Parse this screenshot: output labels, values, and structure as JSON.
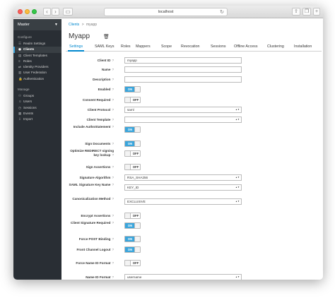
{
  "browser": {
    "url": "localhost"
  },
  "sidebar": {
    "realm": "Master",
    "sections": [
      {
        "title": "Configure",
        "items": [
          {
            "label": "Realm Settings",
            "icon": "sliders-icon",
            "glyph": "☰"
          },
          {
            "label": "Clients",
            "icon": "cube-icon",
            "glyph": "◉",
            "active": true
          },
          {
            "label": "Client Templates",
            "icon": "template-icon",
            "glyph": "▤"
          },
          {
            "label": "Roles",
            "icon": "roles-icon",
            "glyph": "≡"
          },
          {
            "label": "Identity Providers",
            "icon": "exchange-icon",
            "glyph": "⇄"
          },
          {
            "label": "User Federation",
            "icon": "database-icon",
            "glyph": "▥"
          },
          {
            "label": "Authentication",
            "icon": "lock-icon",
            "glyph": "🔒"
          }
        ]
      },
      {
        "title": "Manage",
        "items": [
          {
            "label": "Groups",
            "icon": "users-icon",
            "glyph": "⚇"
          },
          {
            "label": "Users",
            "icon": "user-icon",
            "glyph": "☺"
          },
          {
            "label": "Sessions",
            "icon": "clock-icon",
            "glyph": "◷"
          },
          {
            "label": "Events",
            "icon": "calendar-icon",
            "glyph": "▦"
          },
          {
            "label": "Import",
            "icon": "import-icon",
            "glyph": "⇩"
          }
        ]
      }
    ]
  },
  "breadcrumb": {
    "parent": "Clients",
    "separator": ">",
    "current": "myapp"
  },
  "page": {
    "title": "Myapp"
  },
  "tabs": [
    "Settings",
    "SAML Keys",
    "Roles",
    "Mappers",
    "Scope",
    "Revocation",
    "Sessions",
    "Offline Access",
    "Clustering",
    "Installation"
  ],
  "help_glyph": "?",
  "form": [
    {
      "label": "Client ID",
      "type": "text",
      "value": "myapp"
    },
    {
      "label": "Name",
      "type": "text",
      "value": ""
    },
    {
      "label": "Description",
      "type": "text",
      "value": ""
    },
    {
      "label": "Enabled",
      "type": "toggle",
      "value": "ON"
    },
    {
      "label": "Consent Required",
      "type": "toggle",
      "value": "OFF"
    },
    {
      "label": "Client Protocol",
      "type": "select",
      "value": "saml"
    },
    {
      "label": "Client Template",
      "type": "select",
      "value": ""
    },
    {
      "label": "Include AuthnStatement",
      "type": "toggle",
      "value": "ON"
    },
    {
      "label": "Sign Documents",
      "type": "toggle",
      "value": "ON"
    },
    {
      "label": "Optimize REDIRECT signing key lookup",
      "type": "toggle",
      "value": "OFF"
    },
    {
      "label": "Sign Assertions",
      "type": "toggle",
      "value": "OFF"
    },
    {
      "label": "Signature Algorithm",
      "type": "select",
      "value": "RSA_SHA256"
    },
    {
      "label": "SAML Signature Key Name",
      "type": "select",
      "value": "KEY_ID"
    },
    {
      "label": "Canonicalization Method",
      "type": "select",
      "value": "EXCLUSIVE"
    },
    {
      "label": "Encrypt Assertions",
      "type": "toggle",
      "value": "OFF"
    },
    {
      "label": "Client Signature Required",
      "type": "toggle",
      "value": "ON"
    },
    {
      "label": "Force POST Binding",
      "type": "toggle",
      "value": "ON"
    },
    {
      "label": "Front Channel Logout",
      "type": "toggle",
      "value": "ON"
    },
    {
      "label": "Force Name ID Format",
      "type": "toggle",
      "value": "OFF"
    },
    {
      "label": "Name ID Format",
      "type": "select",
      "value": "username"
    }
  ]
}
